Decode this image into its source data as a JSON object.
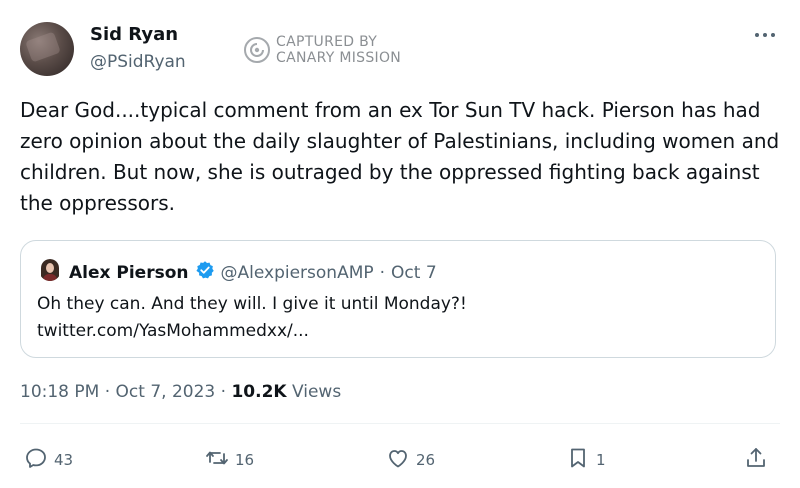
{
  "author": {
    "name": "Sid Ryan",
    "handle": "@PSidRyan"
  },
  "watermark": {
    "line1": "CAPTURED BY",
    "line2": "CANARY MISSION"
  },
  "tweet_text": "Dear God....typical comment from an ex Tor Sun TV hack. Pierson has had zero opinion  about the daily slaughter of Palestinians, including women and children. But now, she is outraged by the oppressed fighting back against the oppressors.",
  "quote": {
    "name": "Alex Pierson",
    "handle": "@AlexpiersonAMP",
    "separator": "·",
    "date": "Oct 7",
    "line1": "Oh they can.  And they will.  I give it until Monday?!",
    "line2": "twitter.com/YasMohammedxx/..."
  },
  "meta": {
    "time": "10:18 PM",
    "sep1": "·",
    "date": "Oct 7, 2023",
    "sep2": "·",
    "views_count": "10.2K",
    "views_label": "Views"
  },
  "actions": {
    "replies": "43",
    "retweets": "16",
    "likes": "26",
    "bookmarks": "1"
  },
  "colors": {
    "text": "#0f1419",
    "secondary": "#536471",
    "border": "#cfd9de",
    "verified": "#1d9bf0"
  }
}
